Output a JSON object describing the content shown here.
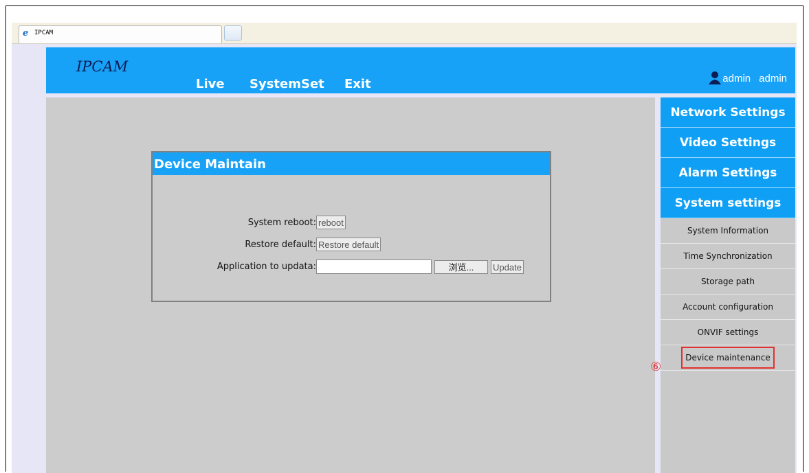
{
  "browser": {
    "tab_title": "IPCAM",
    "tab_icon": "ie-icon"
  },
  "header": {
    "logo": "IPCAM",
    "nav": [
      "Live",
      "SystemSet",
      "Exit"
    ],
    "user": {
      "icon": "user-icon",
      "name": "admin",
      "role": "admin"
    },
    "color": "#18a2f7"
  },
  "panel": {
    "title": "Device Maintain",
    "reboot_label": "System reboot:",
    "reboot_button": "reboot",
    "restore_label": "Restore default:",
    "restore_button": "Restore default",
    "app_label": "Application to updata:",
    "file_value": "",
    "browse_button": "浏览...",
    "update_button": "Update"
  },
  "sidebar": {
    "main_items": [
      "Network Settings",
      "Video Settings",
      "Alarm Settings",
      "System settings"
    ],
    "sub_items": [
      "System Information",
      "Time Synchronization",
      "Storage path",
      "Account configuration",
      "ONVIF settings",
      "Device maintenance"
    ],
    "highlighted": "Device maintenance",
    "annotation": "⑥",
    "highlight_color": "#e23030"
  }
}
